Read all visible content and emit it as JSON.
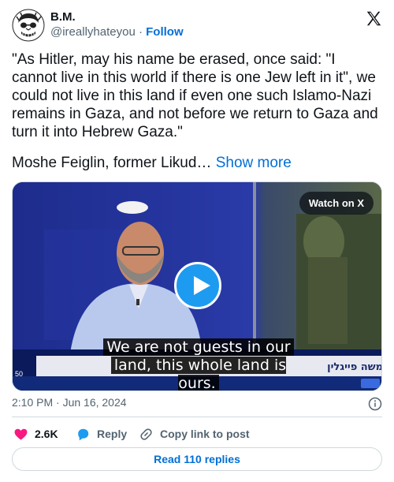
{
  "author": {
    "name": "B.M.",
    "handle": "@ireallyhateyou",
    "separator": "·",
    "follow_label": "Follow"
  },
  "tweet": {
    "text": "\"As Hitler, may his name be erased, once said: \"I cannot live in this world if there is one Jew left in it\", we could not live in this land if even one such Islamo-Nazi remains in Gaza, and not before we return to Gaza and turn it into Hebrew Gaza.\"",
    "text2": "Moshe Feiglin, former Likud…",
    "show_more_label": "Show more"
  },
  "media": {
    "watch_label": "Watch on X",
    "caption_line1": "We are not guests in our",
    "caption_line2": "land, this whole land is ours.",
    "ticker_left": "50",
    "ticker_hebrew": "משה פייגלין"
  },
  "meta": {
    "timestamp": "2:10 PM · Jun 16, 2024"
  },
  "actions": {
    "likes_count": "2.6K",
    "reply_label": "Reply",
    "copy_label": "Copy link to post"
  },
  "footer": {
    "read_replies_label": "Read 110 replies"
  },
  "colors": {
    "link_blue": "#006fd6",
    "like_red": "#f91880",
    "reply_blue": "#1d9bf0",
    "secondary_text": "#536471"
  }
}
